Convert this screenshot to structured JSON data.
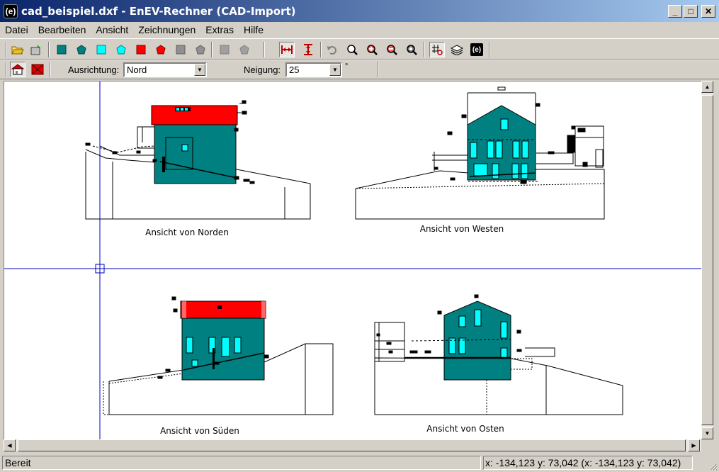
{
  "window": {
    "title": "cad_beispiel.dxf - EnEV-Rechner (CAD-Import)",
    "icon_label": "(e)",
    "minimize_glyph": "_",
    "maximize_glyph": "□",
    "close_glyph": "✕"
  },
  "menu": [
    "Datei",
    "Bearbeiten",
    "Ansicht",
    "Zeichnungen",
    "Extras",
    "Hilfe"
  ],
  "toolbar": {
    "buttons": [
      "open-folder-icon",
      "save-icon",
      "teal-square-icon",
      "teal-pentagon-icon",
      "cyan-square-icon",
      "cyan-pentagon-icon",
      "red-square-icon",
      "red-pentagon-icon",
      "gray-square-icon",
      "gray-pentagon-icon",
      "gray-square-disabled-icon",
      "gray-pentagon-disabled-icon",
      "horizontal-measure-icon",
      "vertical-measure-icon",
      "undo-icon",
      "zoom-icon",
      "zoom-in-icon",
      "zoom-out-icon",
      "zoom-fit-icon",
      "grid-point-icon",
      "layers-icon",
      "enev-logo-icon"
    ],
    "enev_label": "(e)"
  },
  "options": {
    "orientation_label": "Ausrichtung:",
    "orientation_value": "Nord",
    "inclination_label": "Neigung:",
    "inclination_value": "25",
    "inclination_unit": "°"
  },
  "drawing": {
    "views": [
      "Ansicht von Norden",
      "Ansicht von Westen",
      "Ansicht von Süden",
      "Ansicht von Osten"
    ],
    "colors": {
      "wall": "#008080",
      "roof": "#ff0000",
      "window": "#00ffff",
      "crosshair": "#0000c0"
    }
  },
  "status": {
    "left": "Bereit",
    "right": "x: -134,123 y: 73,042 (x: -134,123 y: 73,042)"
  }
}
